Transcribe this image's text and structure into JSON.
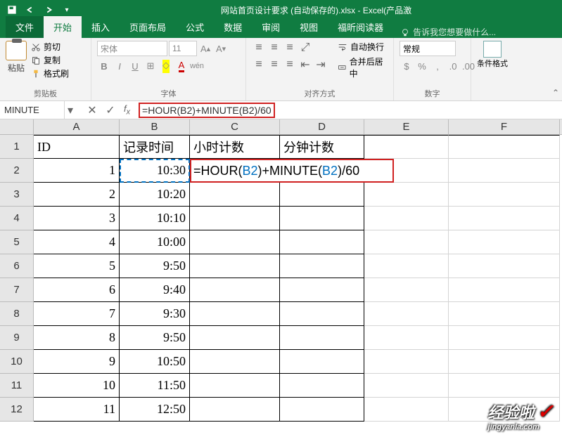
{
  "titlebar": {
    "filename": "网站首页设计要求 (自动保存的).xlsx - Excel(产品激"
  },
  "tabs": {
    "file": "文件",
    "home": "开始",
    "insert": "插入",
    "layout": "页面布局",
    "formulas": "公式",
    "data": "数据",
    "review": "审阅",
    "view": "视图",
    "foxit": "福昕阅读器",
    "tellme": "告诉我您想要做什么..."
  },
  "ribbon": {
    "paste": "粘贴",
    "cut": "剪切",
    "copy": "复制",
    "formatpainter": "格式刷",
    "clipboardGroup": "剪贴板",
    "fontName": "宋体",
    "fontSize": "11",
    "fontGroup": "字体",
    "wrapText": "自动换行",
    "mergeCenter": "合并后居中",
    "alignGroup": "对齐方式",
    "numberFormat": "常规",
    "numberGroup": "数字",
    "condFormat": "条件格式"
  },
  "namebox": "MINUTE",
  "formula": "=HOUR(B2)+MINUTE(B2)/60",
  "columns": [
    "A",
    "B",
    "C",
    "D",
    "E",
    "F"
  ],
  "headers": {
    "A": "ID",
    "B": "记录时间",
    "C": "小时计数",
    "D": "分钟计数"
  },
  "rows": [
    {
      "n": 1
    },
    {
      "n": 2,
      "A": "1",
      "B": "10:30"
    },
    {
      "n": 3,
      "A": "2",
      "B": "10:20"
    },
    {
      "n": 4,
      "A": "3",
      "B": "10:10"
    },
    {
      "n": 5,
      "A": "4",
      "B": "10:00"
    },
    {
      "n": 6,
      "A": "5",
      "B": "9:50"
    },
    {
      "n": 7,
      "A": "6",
      "B": "9:40"
    },
    {
      "n": 8,
      "A": "7",
      "B": "9:30"
    },
    {
      "n": 9,
      "A": "8",
      "B": "9:50"
    },
    {
      "n": 10,
      "A": "9",
      "B": "10:50"
    },
    {
      "n": 11,
      "A": "10",
      "B": "11:50"
    },
    {
      "n": 12,
      "A": "11",
      "B": "12:50"
    }
  ],
  "cellFormula": {
    "pre": "=HOUR(",
    "ref1": "B2",
    "mid": ")+MINUTE(",
    "ref2": "B2",
    "post": ")/60"
  },
  "watermark": {
    "main": "经验啦",
    "sub": "jingyanla.com"
  }
}
